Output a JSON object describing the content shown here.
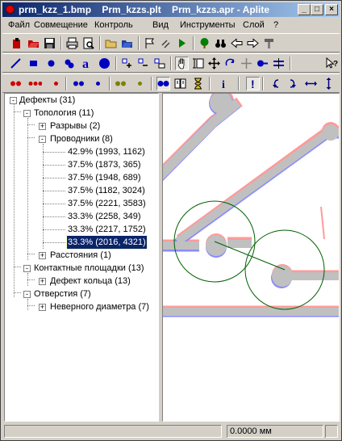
{
  "window": {
    "title": "prm_kzz_1.bmp    Prm_kzzs.plt    Prm_kzzs.apr - Aplite",
    "minimize": "_",
    "maximize": "□",
    "close": "×"
  },
  "menu": [
    "Файл",
    "Совмещение",
    "Контроль",
    "Вид",
    "Инструменты",
    "Слой",
    "?"
  ],
  "toolbar1": [
    "open-image-icon",
    "open-folder-icon",
    "save-icon",
    "print-icon",
    "print-preview-icon",
    "open-project-icon",
    "save-project-icon",
    "flag-icon",
    "link-icon",
    "play-icon",
    "tree-icon",
    "binoculars-icon",
    "arrow-left-icon",
    "arrow-right-icon",
    "hammer-icon"
  ],
  "toolbar2": [
    "line-icon",
    "rectangle-icon",
    "circle-icon",
    "pad-icon",
    "text-icon",
    "big-circle-icon",
    "add-node-icon",
    "delete-node-icon",
    "node-props-icon",
    "hand-icon",
    "text-cursor-icon",
    "move-icon",
    "rotate-icon",
    "align-icon",
    "join-icon",
    "split-icon",
    "help-pointer-icon"
  ],
  "toolbar3": [
    "defect-red-2-icon",
    "defect-red-3-icon",
    "defect-red-1-icon",
    "defect-blue-2-icon",
    "defect-blue-1-icon",
    "defect-olive-2-icon",
    "defect-olive-1-icon",
    "show-pair-icon",
    "compare-icon",
    "hourglass-icon",
    "info-icon",
    "exclamation-icon",
    "curve-left-icon",
    "curve-right-icon",
    "horizontal-arrows-icon",
    "vertical-arrows-icon"
  ],
  "tree": {
    "root": "Дефекты (31)",
    "topology": "Топология (11)",
    "breaks": "Разрывы (2)",
    "conductors": "Проводники (8)",
    "items": [
      "42.9% (1993, 1162)",
      "37.5% (1873, 365)",
      "37.5% (1948, 689)",
      "37.5% (1182, 3024)",
      "37.5% (2221, 3583)",
      "33.3% (2258, 349)",
      "33.3% (2217, 1752)",
      "33.3% (2016, 4321)"
    ],
    "distances": "Расстояния (1)",
    "pads": "Контактные площадки (13)",
    "ring_defect": "Дефект кольца (13)",
    "holes": "Отверстия (7)",
    "wrong_diameter": "Неверного диаметра (7)"
  },
  "status": {
    "measure": "0.0000 мм"
  }
}
